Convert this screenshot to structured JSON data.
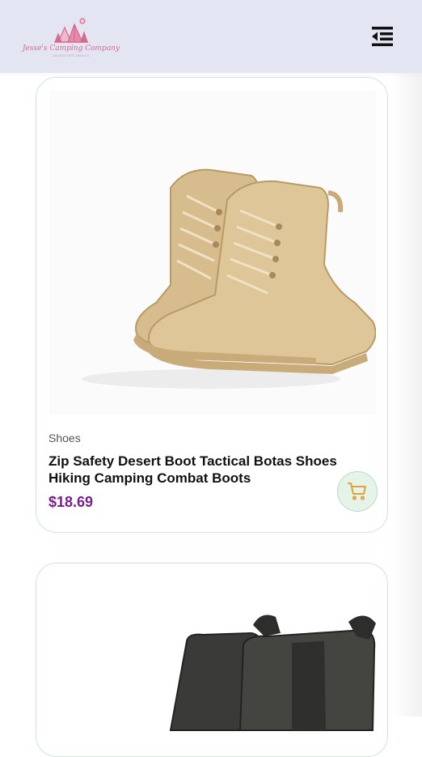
{
  "header": {
    "logo_text": "Jesse's Camping Company",
    "logo_tagline": "ADVENTURE AWAITS",
    "menu_icon": "menu-collapse-icon"
  },
  "products": [
    {
      "category": "Shoes",
      "title": "Zip Safety Desert Boot Tactical Botas Shoes Hiking Camping Combat Boots",
      "price": "$18.69",
      "cart_icon": "shopping-cart-icon"
    }
  ],
  "colors": {
    "header_bg": "#e3e5f3",
    "price": "#7a1e8c",
    "card_border": "#cfe8d6",
    "cart_bg": "#e5f3e8",
    "cart_icon": "#e0a23a",
    "logo": "#d46a8e"
  }
}
